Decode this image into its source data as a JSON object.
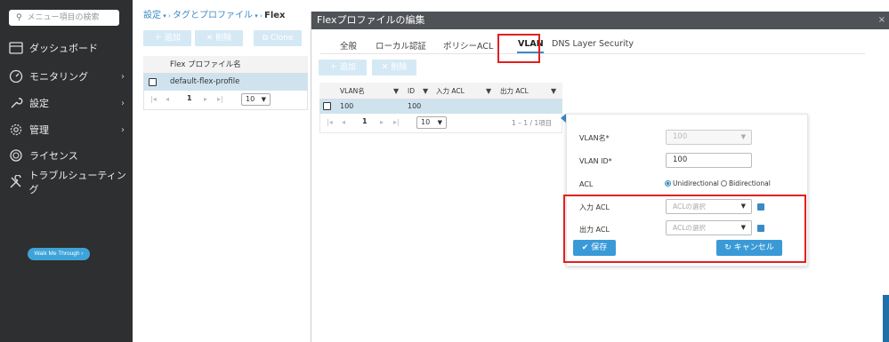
{
  "sidebar": {
    "search_placeholder": "メニュー項目の検索",
    "items": [
      {
        "label": "ダッシュボード",
        "icon": "dashboard-icon",
        "has_arrow": false
      },
      {
        "label": "モニタリング",
        "icon": "monitoring-icon",
        "has_arrow": true
      },
      {
        "label": "設定",
        "icon": "wrench-icon",
        "has_arrow": true
      },
      {
        "label": "管理",
        "icon": "gear-icon",
        "has_arrow": true
      },
      {
        "label": "ライセンス",
        "icon": "license-icon",
        "has_arrow": false
      },
      {
        "label": "トラブルシューティング",
        "icon": "tools-icon",
        "has_arrow": false
      }
    ],
    "walk_me": "Walk Me Through ›"
  },
  "breadcrumb": {
    "item1": "設定",
    "item2": "タグとプロファイル",
    "current": "Flex"
  },
  "toolbar": {
    "add": "＋ 追加",
    "delete": "✕ 削除",
    "clone": "Clone"
  },
  "profile_table": {
    "header": "Flex プロファイル名",
    "rows": [
      "default-flex-profile"
    ],
    "page": "1",
    "page_size": "10"
  },
  "modal": {
    "title": "Flexプロファイルの編集",
    "close": "×",
    "tabs": [
      "全般",
      "ローカル認証",
      "ポリシーACL",
      "VLAN",
      "DNS Layer Security"
    ],
    "active_tab": "VLAN",
    "add": "＋ 追加",
    "delete": "✕ 削除",
    "vlan_table": {
      "headers": [
        "VLAN名",
        "ID",
        "入力 ACL",
        "出力 ACL"
      ],
      "rows": [
        {
          "name": "100",
          "id": "100",
          "in_acl": "",
          "out_acl": ""
        }
      ],
      "page": "1",
      "page_size": "10",
      "range": "1 – 1 / 1項目"
    },
    "form": {
      "vlan_name_label": "VLAN名*",
      "vlan_name_value": "100",
      "vlan_id_label": "VLAN ID*",
      "vlan_id_value": "100",
      "acl_label": "ACL",
      "acl_options": [
        "Unidirectional",
        "Bidirectional"
      ],
      "acl_selected": "Unidirectional",
      "in_acl_label": "入力 ACL",
      "in_acl_placeholder": "ACLの選択",
      "out_acl_label": "出力 ACL",
      "out_acl_placeholder": "ACLの選択",
      "save": "✔ 保存",
      "cancel": "↻ キャンセル"
    }
  },
  "colors": {
    "accent": "#3a8ac4",
    "highlight_box": "#e02020",
    "sidebar_bg": "#2d2f31",
    "selected_row": "#cfe3ef"
  }
}
